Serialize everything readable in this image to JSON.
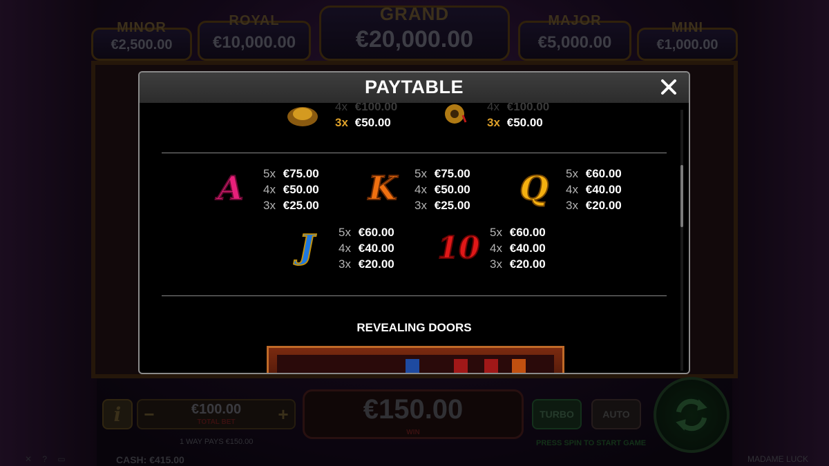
{
  "game": {
    "title": "MADAME LUCK",
    "jackpots": {
      "minor": {
        "name": "MINOR",
        "value": "€2,500.00"
      },
      "royal": {
        "name": "ROYAL",
        "value": "€10,000.00"
      },
      "grand": {
        "name": "GRAND",
        "value": "€20,000.00"
      },
      "major": {
        "name": "MAJOR",
        "value": "€5,000.00"
      },
      "mini": {
        "name": "MINI",
        "value": "€1,000.00"
      }
    },
    "controls": {
      "info_label": "i",
      "bet_minus": "−",
      "bet_plus": "+",
      "total_bet_value": "€100.00",
      "total_bet_label": "TOTAL BET",
      "ways_text": "1 WAY PAYS €150.00",
      "win_value": "€150.00",
      "win_label": "WIN",
      "turbo_label": "TURBO",
      "auto_label": "AUTO",
      "press_spin_text": "PRESS SPIN TO START GAME"
    },
    "footer": {
      "cash_label": "CASH:",
      "cash_value": "€415.00",
      "icon_text": "✕  ?  ▭"
    }
  },
  "paytable": {
    "title": "PAYTABLE",
    "close_label": "✕",
    "top_partial": [
      {
        "lines": [
          {
            "mult": "4x",
            "amount": "€100.00"
          },
          {
            "mult": "3x",
            "amount": "€50.00"
          }
        ]
      },
      {
        "lines": [
          {
            "mult": "4x",
            "amount": "€100.00"
          },
          {
            "mult": "3x",
            "amount": "€50.00"
          }
        ]
      }
    ],
    "symbols": [
      {
        "symbol": "A",
        "color": "#e8207a",
        "lines": [
          {
            "mult": "5x",
            "amount": "€75.00"
          },
          {
            "mult": "4x",
            "amount": "€50.00"
          },
          {
            "mult": "3x",
            "amount": "€25.00"
          }
        ]
      },
      {
        "symbol": "K",
        "color": "#f07010",
        "lines": [
          {
            "mult": "5x",
            "amount": "€75.00"
          },
          {
            "mult": "4x",
            "amount": "€50.00"
          },
          {
            "mult": "3x",
            "amount": "€25.00"
          }
        ]
      },
      {
        "symbol": "Q",
        "color": "#f5b010",
        "lines": [
          {
            "mult": "5x",
            "amount": "€60.00"
          },
          {
            "mult": "4x",
            "amount": "€40.00"
          },
          {
            "mult": "3x",
            "amount": "€20.00"
          }
        ]
      },
      {
        "symbol": "J",
        "color": "#1e78e0",
        "lines": [
          {
            "mult": "5x",
            "amount": "€60.00"
          },
          {
            "mult": "4x",
            "amount": "€40.00"
          },
          {
            "mult": "3x",
            "amount": "€20.00"
          }
        ]
      },
      {
        "symbol": "10",
        "color": "#e01818",
        "lines": [
          {
            "mult": "5x",
            "amount": "€60.00"
          },
          {
            "mult": "4x",
            "amount": "€40.00"
          },
          {
            "mult": "3x",
            "amount": "€20.00"
          }
        ]
      }
    ],
    "section_title": "REVEALING DOORS"
  }
}
